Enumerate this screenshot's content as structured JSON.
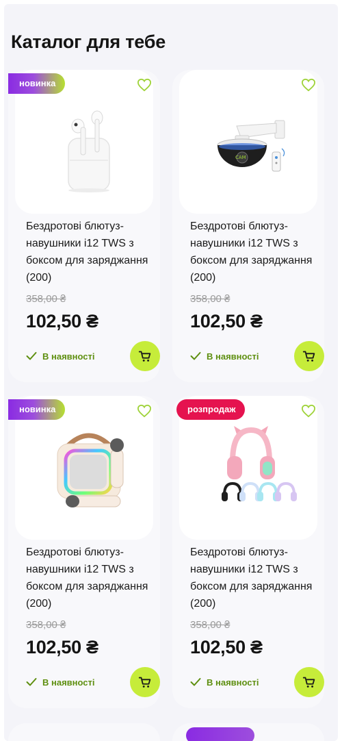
{
  "section": {
    "title": "Каталог для тебе"
  },
  "colors": {
    "accent_green": "#c6ec3a",
    "stock_green": "#5e8f10",
    "badge_purple": "#8a2be2",
    "badge_sale": "#e5134f",
    "fav_outline": "#9fd33a"
  },
  "products": [
    {
      "badge": "новинка",
      "badge_type": "new",
      "image": "wireless-earbuds",
      "title": "Бездротові блютуз-навушники i12 TWS з боксом для заряджання (200)",
      "old_price": "358,00 ₴",
      "price": "102,50 ₴",
      "stock": "В наявності"
    },
    {
      "badge": "",
      "badge_type": "none",
      "image": "dome-camera",
      "title": "Бездротові блютуз-навушники i12 TWS з боксом для заряджання (200)",
      "old_price": "358,00 ₴",
      "price": "102,50 ₴",
      "stock": "В наявності"
    },
    {
      "badge": "новинка",
      "badge_type": "new",
      "image": "karaoke-speaker",
      "title": "Бездротові блютуз-навушники i12 TWS з боксом для заряджання (200)",
      "old_price": "358,00 ₴",
      "price": "102,50 ₴",
      "stock": "В наявності"
    },
    {
      "badge": "розпродаж",
      "badge_type": "sale",
      "image": "cat-ear-headphones",
      "title": "Бездротові блютуз-навушники i12 TWS з боксом для заряджання (200)",
      "old_price": "358,00 ₴",
      "price": "102,50 ₴",
      "stock": "В наявності"
    }
  ]
}
